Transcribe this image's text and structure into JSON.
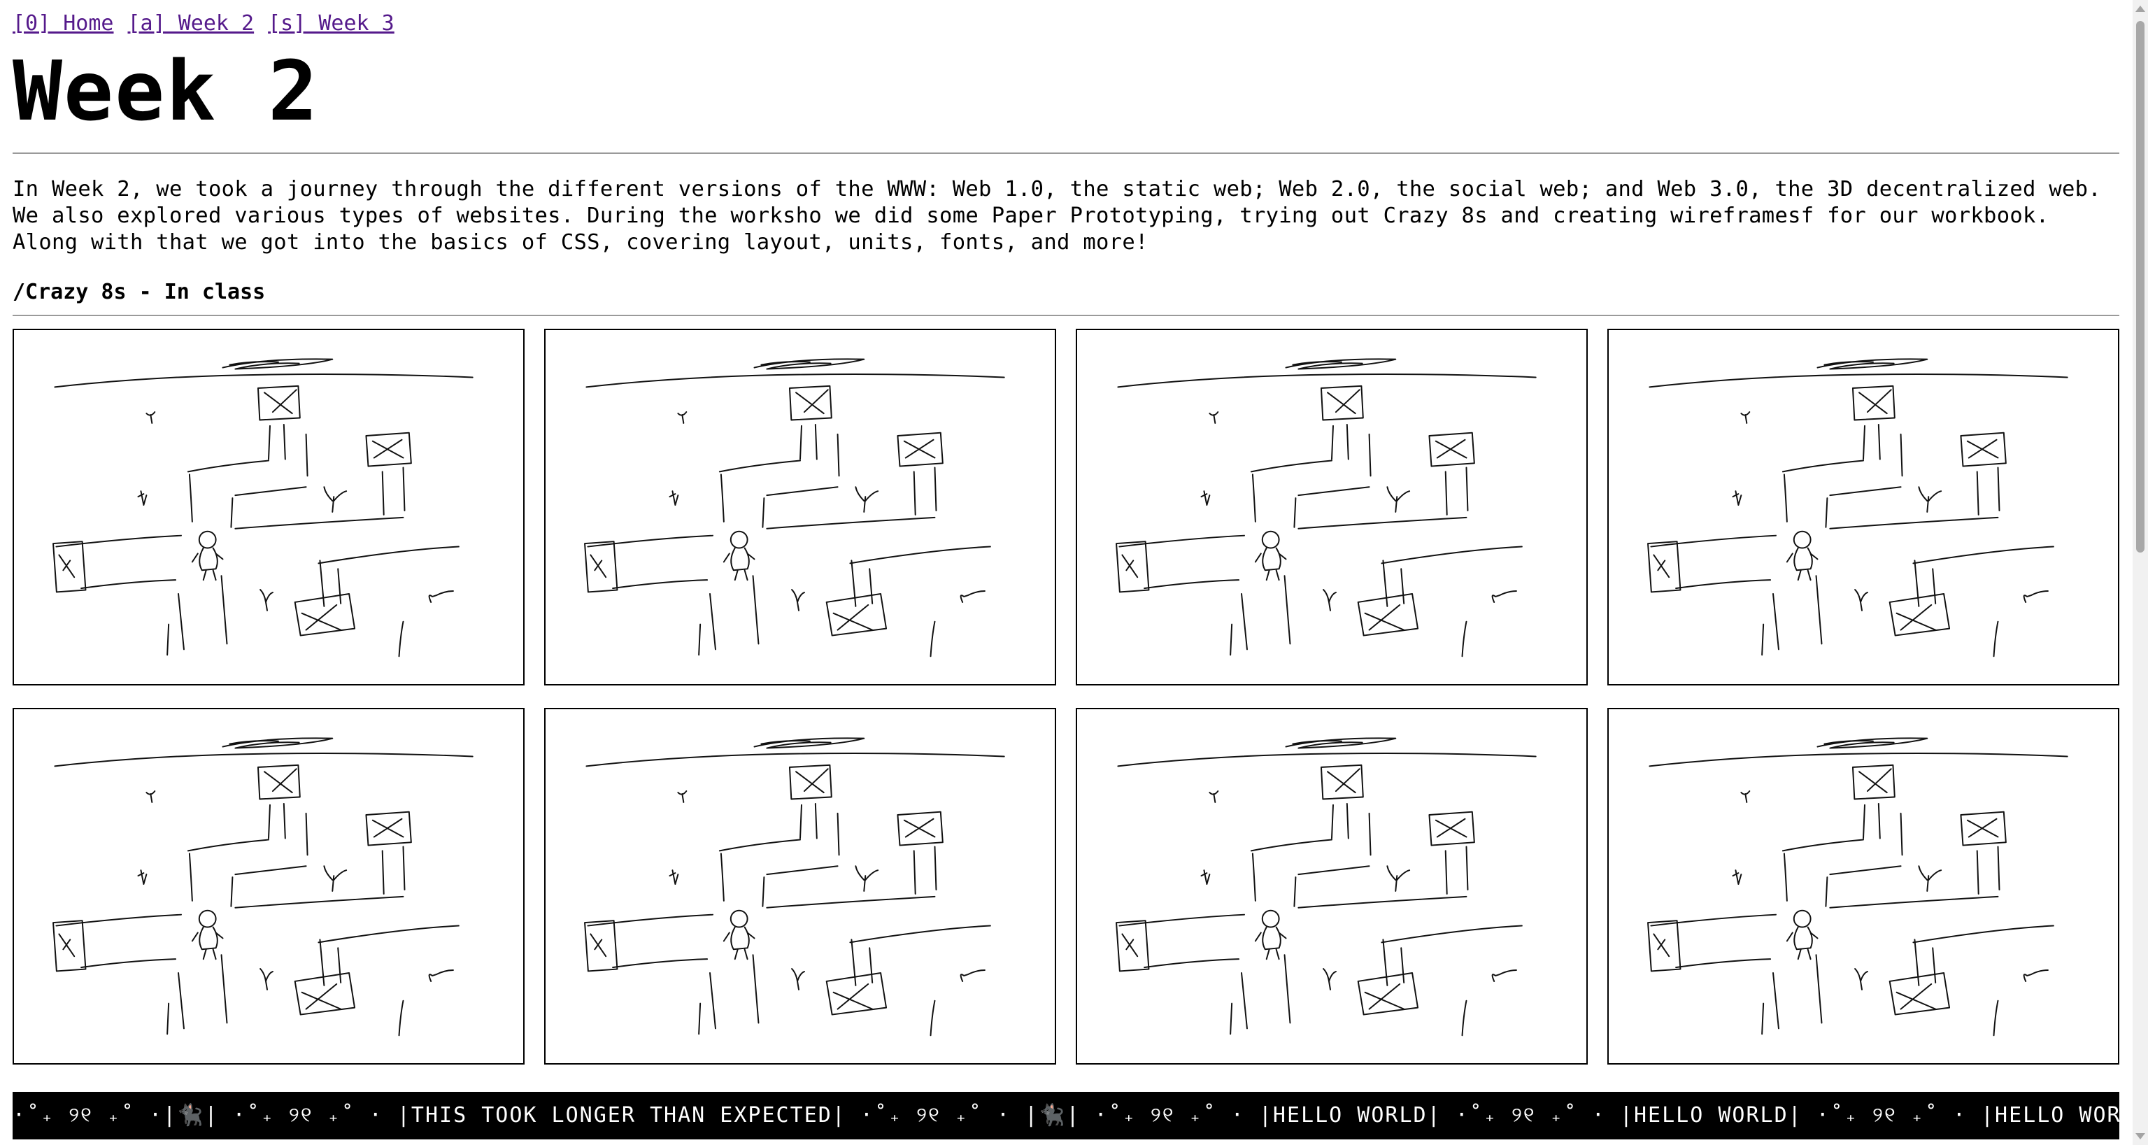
{
  "nav": {
    "links": [
      {
        "label": "[0] Home"
      },
      {
        "label": "[a] Week 2"
      },
      {
        "label": "[s] Week 3"
      }
    ]
  },
  "page": {
    "title": "Week 2",
    "intro": "In Week 2, we took a journey through the different versions of the WWW: Web 1.0, the static web; Web 2.0, the social web; and Web 3.0, the 3D decentralized web. We also explored various types of websites. During the worksho we did some Paper Prototyping, trying out Crazy 8s and creating wireframesf for our workbook. Along with that we got into the basics of CSS, covering layout, units, fonts, and more!",
    "section_heading": "/Crazy 8s - In class"
  },
  "gallery": {
    "panels": [
      {
        "name": "sketch-1"
      },
      {
        "name": "sketch-2"
      },
      {
        "name": "sketch-3"
      },
      {
        "name": "sketch-4"
      },
      {
        "name": "sketch-5"
      },
      {
        "name": "sketch-6"
      },
      {
        "name": "sketch-7"
      },
      {
        "name": "sketch-8"
      }
    ]
  },
  "ticker": {
    "segments": [
      "·˚₊ ୨୧ ₊˚ · ",
      "| ",
      "🐈‍⬛",
      " | ·˚₊ ୨୧ ₊˚ · | ",
      "THIS TOOK LONGER THAN EXPECTED",
      " | ·˚₊ ୨୧ ₊˚ · | ",
      "🐈‍⬛",
      " | ·˚₊ ୨୧ ₊˚ · | ",
      "HELLO WORLD",
      " | ·˚₊ ୨୧ ₊˚ · | ",
      "HELLO WORLD",
      " | ·˚₊ ୨୧ ₊˚ · | ",
      "HELLO WORLD",
      " | ·"
    ],
    "accent_color": "#8a7fd6",
    "background": "#000000"
  }
}
